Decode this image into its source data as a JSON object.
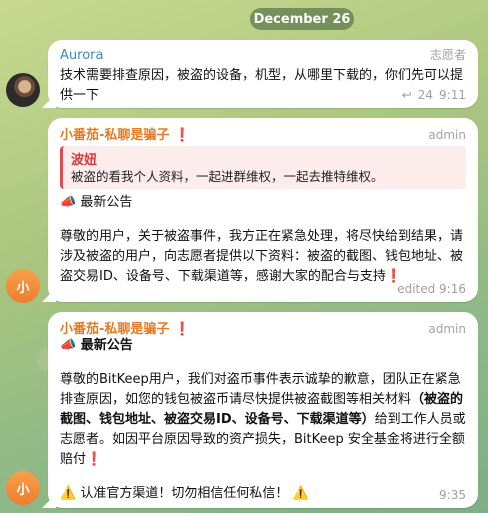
{
  "date_chip": "December 26",
  "messages": [
    {
      "sender": "Aurora",
      "role": "志愿者",
      "text": "技术需要排查原因，被盗的设备，机型，从哪里下载的，你们先可以提供一下",
      "reply_icon": "↩",
      "reply_count": "24",
      "time": "9:11"
    },
    {
      "sender": "小番茄-私聊是骗子",
      "sender_mark": "❗",
      "role": "admin",
      "quote_sender": "波妞",
      "quote_text": "被盗的看我个人资料，一起进群维权，一起去推特维权。",
      "announce_icon": "📣",
      "announce_title": "最新公告",
      "body": "尊敬的用户，关于被盗事件，我方正在紧急处理，将尽快给到结果，请涉及被盗的用户，向志愿者提供以下资料：被盗的截图、钱包地址、被盗交易ID、设备号、下载渠道等，感谢大家的配合与支持",
      "body_mark": "❗",
      "time": "edited 9:16",
      "avatar_letter": "小"
    },
    {
      "sender": "小番茄-私聊是骗子",
      "sender_mark": "❗",
      "role": "admin",
      "announce_icon": "📣",
      "announce_title": "最新公告",
      "body_part1": "尊敬的BitKeep用户，我们对盗币事件表示诚挚的歉意，团队正在紧急排查原因，如您的钱包被盗币请尽快提供被盗截图等相关材料",
      "body_bold": "（被盗的截图、钱包地址、被盗交易ID、设备号、下载渠道等）",
      "body_part2": "给到工作人员或志愿者。如因平台原因导致的资产损失，BitKeep 安全基金将进行全额赔付",
      "body_mark": "❗",
      "warning_icon": "⚠️",
      "warning_text": "认准官方渠道！切勿相信任何私信！",
      "time": "9:35",
      "avatar_letter": "小"
    }
  ]
}
